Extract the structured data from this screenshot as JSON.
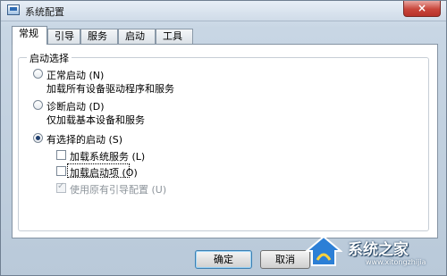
{
  "window": {
    "title": "系统配置",
    "close_label": "×"
  },
  "tabs": [
    "常规",
    "引导",
    "服务",
    "启动",
    "工具"
  ],
  "startup": {
    "group_label": "启动选择",
    "normal": {
      "label": "正常启动",
      "hotkey": "(N)",
      "desc": "加载所有设备驱动程序和服务"
    },
    "diagnostic": {
      "label": "诊断启动",
      "hotkey": "(D)",
      "desc": "仅加载基本设备和服务"
    },
    "selective": {
      "label": "有选择的启动",
      "hotkey": "(S)"
    },
    "options": [
      {
        "label": "加载系统服务",
        "hotkey": "(L)",
        "checked": false
      },
      {
        "label": "加载启动项",
        "hotkey": "(O)",
        "checked": false
      },
      {
        "label": "使用原有引导配置",
        "hotkey": "(U)",
        "checked": true,
        "disabled": true
      }
    ],
    "selected": "selective"
  },
  "buttons": {
    "ok": "确定",
    "cancel": "取消"
  },
  "watermark": {
    "text": "系统之家",
    "url": "www.xitongzhijia"
  }
}
